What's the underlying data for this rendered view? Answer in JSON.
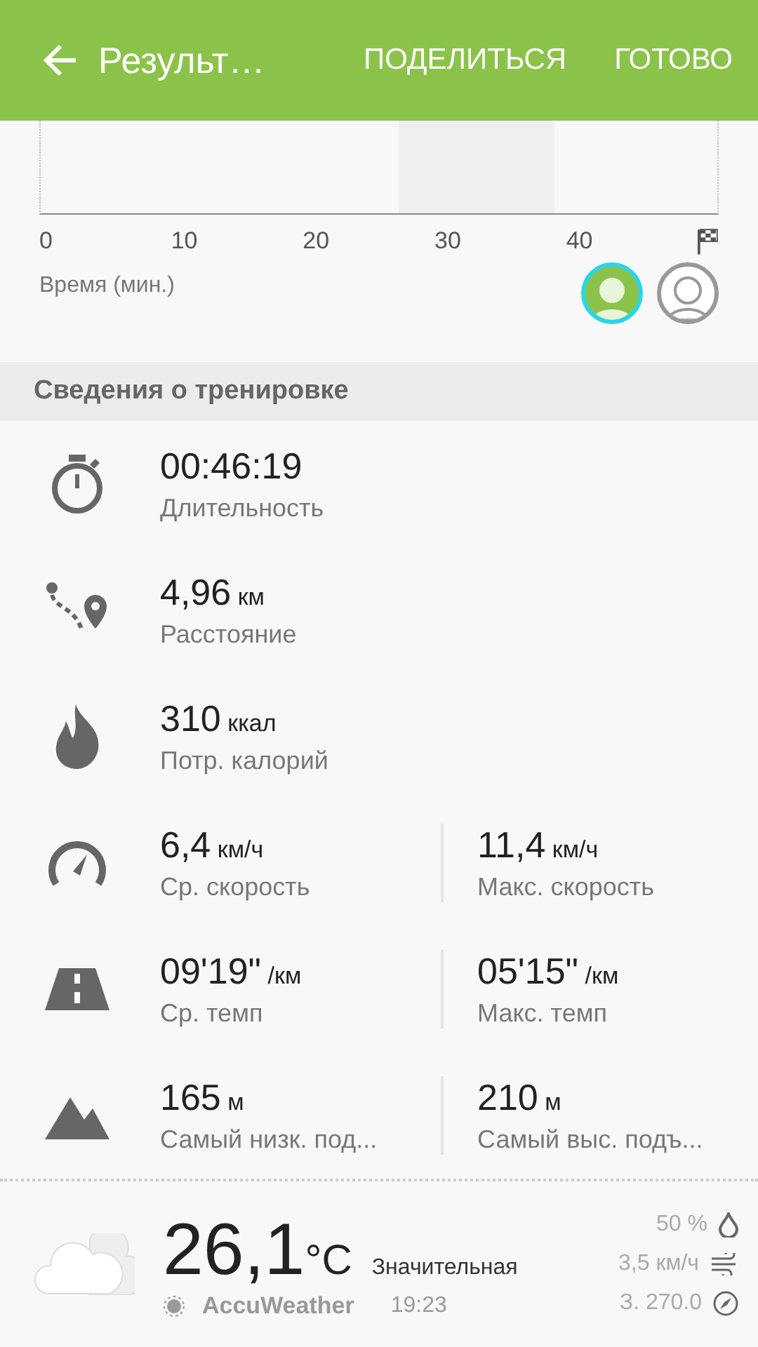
{
  "app_bar": {
    "title": "Результ…",
    "actions": [
      "ПОДЕЛИТЬСЯ",
      "ГОТОВО"
    ]
  },
  "chart": {
    "x_ticks": [
      "0",
      "10",
      "20",
      "30",
      "40"
    ],
    "x_label": "Время (мин.)",
    "avatars": [
      {
        "selected": true
      },
      {
        "selected": false
      }
    ]
  },
  "section": {
    "title": "Сведения о тренировке"
  },
  "stats": [
    {
      "cells": [
        {
          "value": "00:46:19",
          "label": "Длительность"
        }
      ]
    },
    {
      "cells": [
        {
          "value": "4,96",
          "unit": "км",
          "label": "Расстояние"
        }
      ]
    },
    {
      "cells": [
        {
          "value": "310",
          "unit": "ккал",
          "label": "Потр. калорий"
        }
      ]
    },
    {
      "cells": [
        {
          "value": "6,4",
          "unit": "км/ч",
          "label": "Ср. скорость"
        },
        {
          "value": "11,4",
          "unit": "км/ч",
          "label": "Макс. скорость"
        }
      ]
    },
    {
      "cells": [
        {
          "value": "09'19\"",
          "unit": "/км",
          "label": "Ср. темп"
        },
        {
          "value": "05'15\"",
          "unit": "/км",
          "label": "Макс. темп"
        }
      ]
    },
    {
      "cells": [
        {
          "value": "165",
          "unit": "м",
          "label": "Самый низк. под..."
        },
        {
          "value": "210",
          "unit": "м",
          "label": "Самый выс. подъ..."
        }
      ]
    }
  ],
  "weather": {
    "temperature": "26,1",
    "unit": "°C",
    "condition": "Значительная",
    "provider": "AccuWeather",
    "time": "19:23",
    "humidity": "50 %",
    "wind": "3,5 км/ч",
    "direction": "З. 270.0"
  }
}
